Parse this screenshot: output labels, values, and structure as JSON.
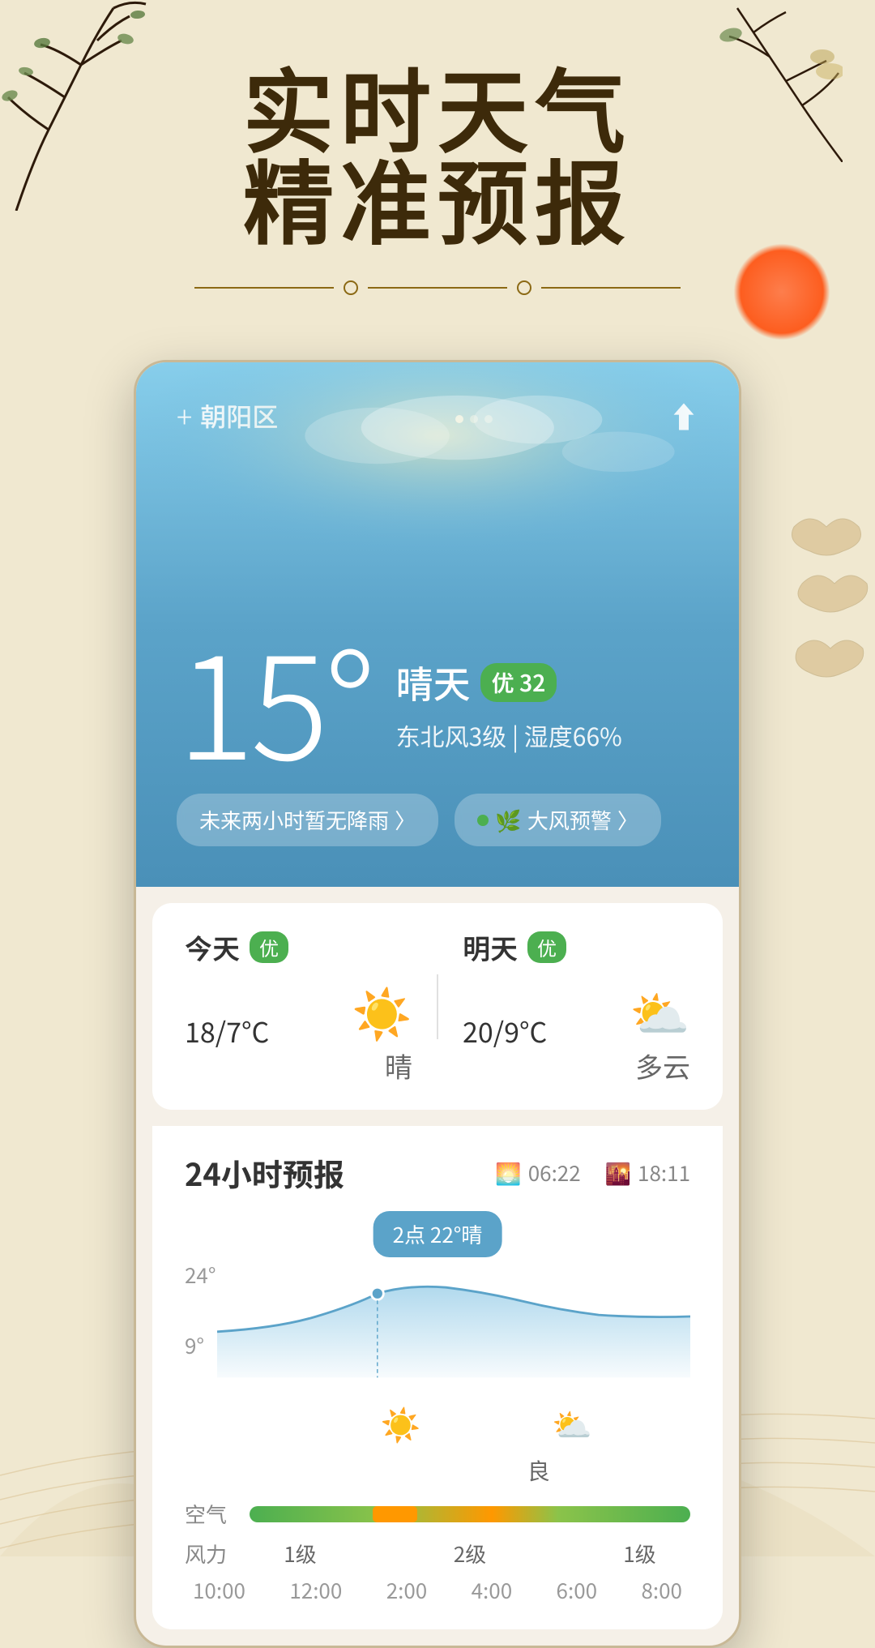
{
  "hero": {
    "title_line1": "实时天气",
    "title_line2": "精准预报"
  },
  "weather_card": {
    "location": "朝阳区",
    "add_label": "+",
    "temperature": "15°",
    "condition": "晴天",
    "aqi": "优 32",
    "wind_humidity": "东北风3级 | 湿度66%",
    "alert1": "未来两小时暂无降雨 〉",
    "alert2": "🌿 大风预警 〉",
    "today_label": "今天",
    "today_badge": "优",
    "today_temp": "18/7°C",
    "today_weather": "晴",
    "tomorrow_label": "明天",
    "tomorrow_badge": "优",
    "tomorrow_temp": "20/9°C",
    "tomorrow_weather": "多云",
    "forecast_24h_title": "24小时预报",
    "sunrise": "06:22",
    "sunset": "18:11",
    "chart_tooltip": "2点 22°晴",
    "chart_high": "24°",
    "chart_low": "9°",
    "quality_label": "良",
    "air_quality_label": "空气",
    "wind_label": "风力",
    "wind_levels": [
      "1级",
      "2级",
      "1级"
    ],
    "time_labels": [
      "10:00",
      "12:00",
      "2:00",
      "4:00",
      "6:00",
      "8:00"
    ]
  }
}
